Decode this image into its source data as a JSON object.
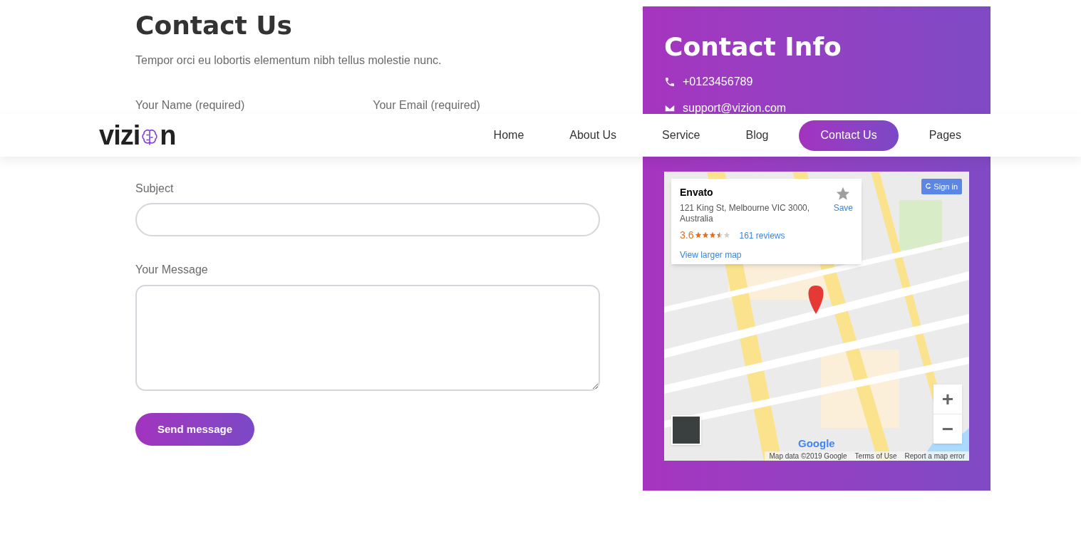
{
  "header": {
    "logo": {
      "before": "vizi",
      "after": "n"
    },
    "nav": [
      {
        "label": "Home",
        "selected": false
      },
      {
        "label": "About Us",
        "selected": false
      },
      {
        "label": "Service",
        "selected": false
      },
      {
        "label": "Blog",
        "selected": false
      },
      {
        "label": "Contact Us",
        "selected": true
      },
      {
        "label": "Pages",
        "selected": false
      }
    ]
  },
  "form": {
    "title": "Contact Us",
    "subtitle": "Tempor orci eu lobortis elementum nibh tellus molestie nunc.",
    "name_label": "Your Name (required)",
    "email_label": "Your Email (required)",
    "subject_label": "Subject",
    "message_label": "Your Message",
    "submit": "Send message"
  },
  "contact_info": {
    "title": "Contact Info",
    "phone": "+0123456789",
    "email": "support@vizion.com",
    "map": {
      "place": {
        "name": "Envato",
        "address": "121 King St, Melbourne VIC 3000, Australia",
        "rating": "3.6",
        "stars": 3.5,
        "reviews": "161 reviews",
        "save": "Save",
        "larger_map": "View larger map"
      },
      "sign_in": "Sign in",
      "zoom_in": "+",
      "zoom_out": "−",
      "google_logo": "Google",
      "footer": [
        "Map data ©2019 Google",
        "Terms of Use",
        "Report a map error"
      ]
    }
  }
}
